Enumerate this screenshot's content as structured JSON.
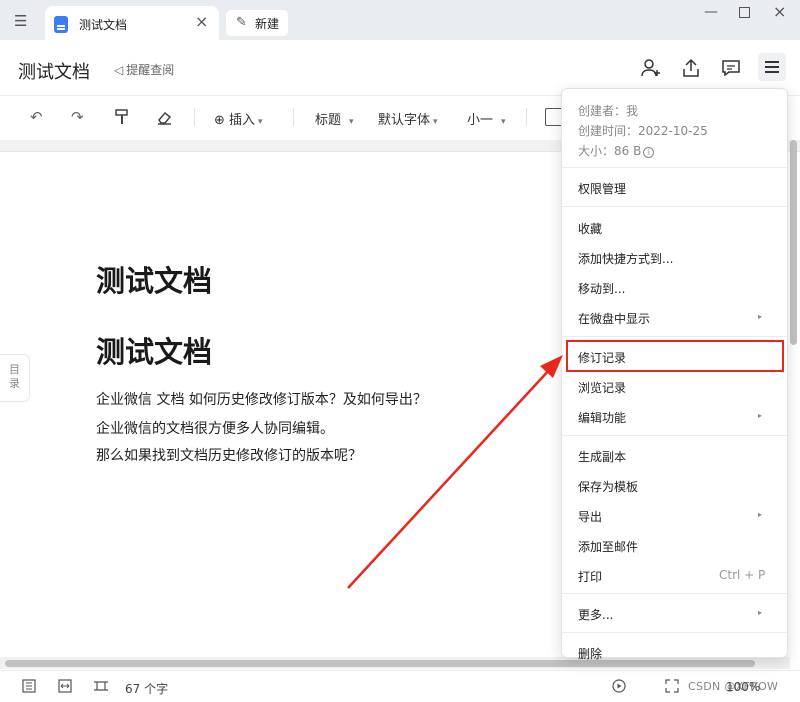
{
  "window": {
    "tab_title": "测试文档",
    "tab_close": "×",
    "new_tab_label": "新建",
    "minimize": "—",
    "close": "×"
  },
  "header": {
    "doc_title": "测试文档",
    "remind_label": "提醒查阅"
  },
  "toolbar": {
    "insert_label": "插入",
    "heading_label": "标题",
    "font_label": "默认字体",
    "size_label": "小一",
    "caret": "▾"
  },
  "document": {
    "heading_1": "测试文档",
    "heading_2": "测试文档",
    "paragraphs": [
      "企业微信  文档  如何历史修改修订版本？及如何导出？",
      "企业微信的文档很方便多人协同编辑。",
      "那么如果找到文档历史修改修订的版本呢？"
    ],
    "toc_label": "目录"
  },
  "menu": {
    "creator": "创建者：我",
    "created_time": "创建时间：2022-10-25",
    "size": "大小：86 B",
    "info_icon": "i",
    "items": [
      {
        "label": "权限管理"
      },
      {
        "label": "收藏"
      },
      {
        "label": "添加快捷方式到..."
      },
      {
        "label": "移动到..."
      },
      {
        "label": "在微盘中显示",
        "submenu": true
      },
      {
        "label": "修订记录",
        "highlighted": true
      },
      {
        "label": "浏览记录"
      },
      {
        "label": "编辑功能",
        "submenu": true
      },
      {
        "label": "生成副本"
      },
      {
        "label": "保存为模板"
      },
      {
        "label": "导出",
        "submenu": true
      },
      {
        "label": "添加至邮件"
      },
      {
        "label": "打印",
        "shortcut": "Ctrl + P"
      },
      {
        "label": "更多...",
        "submenu": true
      },
      {
        "label": "删除"
      }
    ],
    "submenu_arrow": "▸",
    "highlight_color": "#e8281c"
  },
  "statusbar": {
    "word_count": "67 个字",
    "zoom": "100%"
  },
  "watermark": "CSDN @XFROW",
  "colors": {
    "accent_blue": "#3b7df5",
    "annotation_red": "#e8281c"
  }
}
